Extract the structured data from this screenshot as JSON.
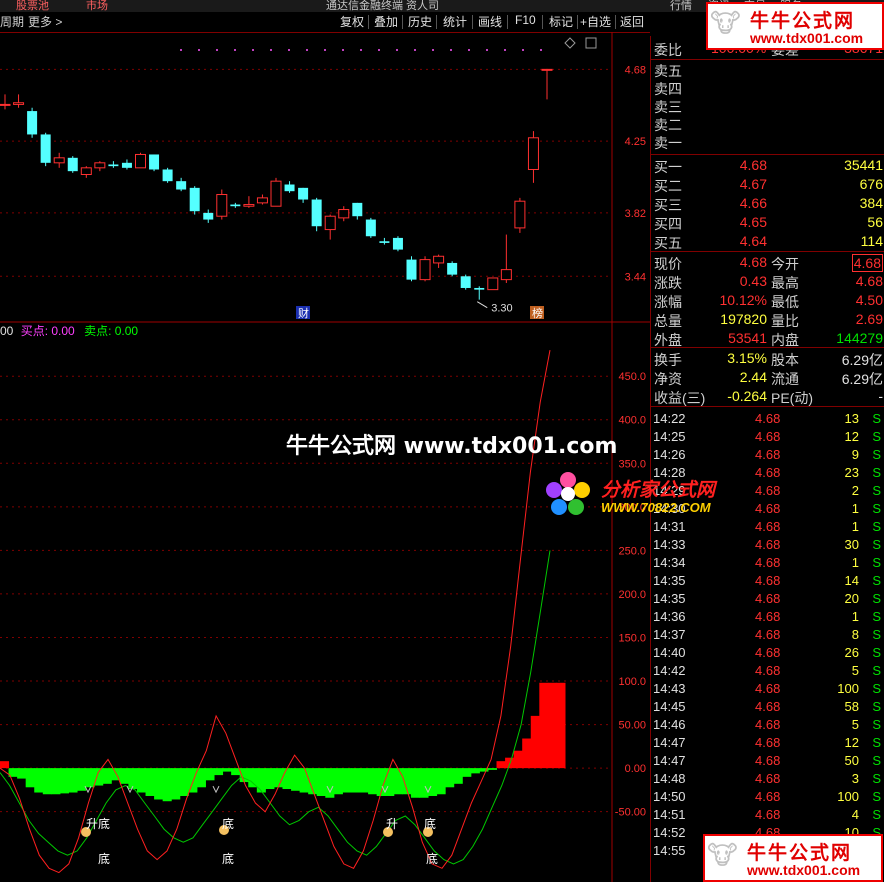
{
  "topbar": {
    "left1": "股票池",
    "left2": "市场",
    "center": "通达信金融终端 资人司",
    "r1": "行情",
    "r2": "资讯",
    "r3": "交易",
    "r4": "服务"
  },
  "toolbar": {
    "period": "周期",
    "more": "更多",
    "buttons": [
      "复权",
      "叠加",
      "历史",
      "统计",
      "画线",
      "F10",
      "标记",
      "+自选",
      "返回"
    ]
  },
  "indicator_label": {
    "prefix": "00",
    "buy": "买点: 0.00",
    "sell": "卖点: 0.00"
  },
  "watermarks": {
    "main": "牛牛公式网 www.tdx001.com",
    "fxj": "分析家公式网",
    "fxj_url": "WWW.70822.COM",
    "logo_text": "牛牛公式网",
    "logo_url": "www.tdx001.com"
  },
  "annotations": {
    "min_price": "3.30",
    "cai": "财",
    "bang": "榜"
  },
  "signals": {
    "sheng_di": "升底",
    "di": "底",
    "sheng": "升"
  },
  "colors": {
    "up": "#ff3030",
    "down": "#54ffff",
    "green_bar": "#00ff00",
    "red_bar": "#ff0000",
    "grid": "#800000"
  },
  "quote": {
    "weibi": {
      "label": "委比",
      "value": "100.00%",
      "label2": "委差",
      "value2": "38671"
    },
    "sell": [
      {
        "label": "卖五"
      },
      {
        "label": "卖四"
      },
      {
        "label": "卖三"
      },
      {
        "label": "卖二"
      },
      {
        "label": "卖一"
      }
    ],
    "buy": [
      {
        "label": "买一",
        "price": "4.68",
        "vol": "35441"
      },
      {
        "label": "买二",
        "price": "4.67",
        "vol": "676"
      },
      {
        "label": "买三",
        "price": "4.66",
        "vol": "384"
      },
      {
        "label": "买四",
        "price": "4.65",
        "vol": "56"
      },
      {
        "label": "买五",
        "price": "4.64",
        "vol": "114"
      }
    ],
    "stats": [
      {
        "l": "现价",
        "v": "4.68",
        "l2": "今开",
        "v2": "4.68"
      },
      {
        "l": "涨跌",
        "v": "0.43",
        "l2": "最高",
        "v2": "4.68"
      },
      {
        "l": "涨幅",
        "v": "10.12%",
        "l2": "最低",
        "v2": "4.50"
      },
      {
        "l": "总量",
        "v": "197820",
        "l2": "量比",
        "v2": "2.69"
      },
      {
        "l": "外盘",
        "v": "53541",
        "l2": "内盘",
        "v2": "144279"
      }
    ],
    "stats2": [
      {
        "l": "换手",
        "v": "3.15%",
        "l2": "股本",
        "v2": "6.29亿"
      },
      {
        "l": "净资",
        "v": "2.44",
        "l2": "流通",
        "v2": "6.29亿"
      },
      {
        "l": "收益(三)",
        "v": "-0.264",
        "l2": "PE(动)",
        "v2": "-"
      }
    ]
  },
  "ticks": [
    {
      "t": "14:22",
      "p": "4.68",
      "q": "13",
      "s": "S"
    },
    {
      "t": "14:25",
      "p": "4.68",
      "q": "12",
      "s": "S"
    },
    {
      "t": "14:26",
      "p": "4.68",
      "q": "9",
      "s": "S"
    },
    {
      "t": "14:28",
      "p": "4.68",
      "q": "23",
      "s": "S"
    },
    {
      "t": "14:29",
      "p": "4.68",
      "q": "2",
      "s": "S"
    },
    {
      "t": "14:30",
      "p": "4.68",
      "q": "1",
      "s": "S"
    },
    {
      "t": "14:31",
      "p": "4.68",
      "q": "1",
      "s": "S"
    },
    {
      "t": "14:33",
      "p": "4.68",
      "q": "30",
      "s": "S"
    },
    {
      "t": "14:34",
      "p": "4.68",
      "q": "1",
      "s": "S"
    },
    {
      "t": "14:35",
      "p": "4.68",
      "q": "14",
      "s": "S"
    },
    {
      "t": "14:35",
      "p": "4.68",
      "q": "20",
      "s": "S"
    },
    {
      "t": "14:36",
      "p": "4.68",
      "q": "1",
      "s": "S"
    },
    {
      "t": "14:37",
      "p": "4.68",
      "q": "8",
      "s": "S"
    },
    {
      "t": "14:40",
      "p": "4.68",
      "q": "26",
      "s": "S"
    },
    {
      "t": "14:42",
      "p": "4.68",
      "q": "5",
      "s": "S"
    },
    {
      "t": "14:43",
      "p": "4.68",
      "q": "100",
      "s": "S"
    },
    {
      "t": "14:45",
      "p": "4.68",
      "q": "58",
      "s": "S"
    },
    {
      "t": "14:46",
      "p": "4.68",
      "q": "5",
      "s": "S"
    },
    {
      "t": "14:47",
      "p": "4.68",
      "q": "12",
      "s": "S"
    },
    {
      "t": "14:47",
      "p": "4.68",
      "q": "50",
      "s": "S"
    },
    {
      "t": "14:48",
      "p": "4.68",
      "q": "3",
      "s": "S"
    },
    {
      "t": "14:50",
      "p": "4.68",
      "q": "100",
      "s": "S"
    },
    {
      "t": "14:51",
      "p": "4.68",
      "q": "4",
      "s": "S"
    },
    {
      "t": "14:52",
      "p": "4.68",
      "q": "10",
      "s": "S"
    },
    {
      "t": "14:55",
      "p": "4.68",
      "q": "4",
      "s": "S"
    }
  ],
  "chart_data": [
    {
      "type": "candlestick",
      "y_ticks": [
        "4.68",
        "4.25",
        "3.82",
        "3.44"
      ],
      "ylim": [
        3.25,
        4.82
      ],
      "candles": [
        {
          "o": 4.47,
          "h": 4.53,
          "l": 4.44,
          "c": 4.47
        },
        {
          "o": 4.47,
          "h": 4.53,
          "l": 4.45,
          "c": 4.48
        },
        {
          "o": 4.43,
          "h": 4.45,
          "l": 4.27,
          "c": 4.29
        },
        {
          "o": 4.29,
          "h": 4.3,
          "l": 4.1,
          "c": 4.12
        },
        {
          "o": 4.12,
          "h": 4.18,
          "l": 4.09,
          "c": 4.15
        },
        {
          "o": 4.15,
          "h": 4.16,
          "l": 4.06,
          "c": 4.07
        },
        {
          "o": 4.05,
          "h": 4.1,
          "l": 4.03,
          "c": 4.09
        },
        {
          "o": 4.09,
          "h": 4.13,
          "l": 4.07,
          "c": 4.12
        },
        {
          "o": 4.11,
          "h": 4.13,
          "l": 4.09,
          "c": 4.1
        },
        {
          "o": 4.12,
          "h": 4.14,
          "l": 4.08,
          "c": 4.09
        },
        {
          "o": 4.09,
          "h": 4.18,
          "l": 4.09,
          "c": 4.17
        },
        {
          "o": 4.17,
          "h": 4.17,
          "l": 4.07,
          "c": 4.08
        },
        {
          "o": 4.08,
          "h": 4.09,
          "l": 4.0,
          "c": 4.01
        },
        {
          "o": 4.01,
          "h": 4.03,
          "l": 3.95,
          "c": 3.96
        },
        {
          "o": 3.97,
          "h": 3.98,
          "l": 3.81,
          "c": 3.83
        },
        {
          "o": 3.82,
          "h": 3.84,
          "l": 3.76,
          "c": 3.78
        },
        {
          "o": 3.8,
          "h": 3.96,
          "l": 3.78,
          "c": 3.93
        },
        {
          "o": 3.87,
          "h": 3.88,
          "l": 3.85,
          "c": 3.86
        },
        {
          "o": 3.86,
          "h": 3.92,
          "l": 3.85,
          "c": 3.87
        },
        {
          "o": 3.88,
          "h": 3.93,
          "l": 3.87,
          "c": 3.91
        },
        {
          "o": 3.86,
          "h": 4.03,
          "l": 3.86,
          "c": 4.01
        },
        {
          "o": 3.99,
          "h": 4.01,
          "l": 3.94,
          "c": 3.95
        },
        {
          "o": 3.97,
          "h": 3.97,
          "l": 3.88,
          "c": 3.9
        },
        {
          "o": 3.9,
          "h": 3.91,
          "l": 3.71,
          "c": 3.74
        },
        {
          "o": 3.72,
          "h": 3.81,
          "l": 3.66,
          "c": 3.8
        },
        {
          "o": 3.79,
          "h": 3.86,
          "l": 3.77,
          "c": 3.84
        },
        {
          "o": 3.88,
          "h": 3.88,
          "l": 3.78,
          "c": 3.8
        },
        {
          "o": 3.78,
          "h": 3.79,
          "l": 3.67,
          "c": 3.68
        },
        {
          "o": 3.65,
          "h": 3.67,
          "l": 3.63,
          "c": 3.64
        },
        {
          "o": 3.67,
          "h": 3.68,
          "l": 3.59,
          "c": 3.6
        },
        {
          "o": 3.54,
          "h": 3.56,
          "l": 3.41,
          "c": 3.42
        },
        {
          "o": 3.42,
          "h": 3.56,
          "l": 3.41,
          "c": 3.54
        },
        {
          "o": 3.52,
          "h": 3.57,
          "l": 3.49,
          "c": 3.56
        },
        {
          "o": 3.52,
          "h": 3.53,
          "l": 3.44,
          "c": 3.45
        },
        {
          "o": 3.44,
          "h": 3.45,
          "l": 3.36,
          "c": 3.37
        },
        {
          "o": 3.37,
          "h": 3.38,
          "l": 3.3,
          "c": 3.36
        },
        {
          "o": 3.36,
          "h": 3.43,
          "l": 3.36,
          "c": 3.43
        },
        {
          "o": 3.42,
          "h": 3.69,
          "l": 3.4,
          "c": 3.48
        },
        {
          "o": 3.73,
          "h": 3.91,
          "l": 3.7,
          "c": 3.89
        },
        {
          "o": 4.08,
          "h": 4.31,
          "l": 4.0,
          "c": 4.27
        },
        {
          "o": 4.68,
          "h": 4.68,
          "l": 4.5,
          "c": 4.68
        }
      ]
    },
    {
      "type": "bar",
      "title": "",
      "y_ticks": [
        "450.0",
        "400.0",
        "350.0",
        "300.0",
        "250.0",
        "200.0",
        "150.0",
        "100.0",
        "50.00",
        "0.00",
        "-50.00"
      ],
      "ylim": [
        -125,
        495
      ],
      "values": [
        8,
        -10,
        -12,
        -22,
        -28,
        -30,
        -30,
        -29,
        -28,
        -26,
        -22,
        -20,
        -18,
        -14,
        -18,
        -24,
        -28,
        -32,
        -36,
        -38,
        -36,
        -32,
        -28,
        -22,
        -14,
        -8,
        -4,
        -8,
        -16,
        -22,
        -28,
        -24,
        -22,
        -24,
        -26,
        -28,
        -30,
        -32,
        -34,
        -30,
        -28,
        -28,
        -28,
        -30,
        -32,
        -32,
        -30,
        -30,
        -34,
        -34,
        -32,
        -30,
        -22,
        -18,
        -10,
        -6,
        -4,
        -2,
        8,
        12,
        20,
        34,
        60,
        98,
        98,
        98
      ],
      "series": [
        {
          "values": [
            -5,
            -20,
            -40,
            -60,
            -75,
            -85,
            -95,
            -100,
            -95,
            -80,
            -60,
            -40,
            -25,
            -20,
            -25,
            -40,
            -55,
            -70,
            -80,
            -85,
            -80,
            -65,
            -50,
            -35,
            -20,
            -10,
            -15,
            -25,
            -40,
            -55,
            -65,
            -60,
            -50,
            -45,
            -55,
            -70,
            -85,
            -95,
            -100,
            -90,
            -75,
            -60,
            -55,
            -65,
            -80,
            -95,
            -105,
            -110,
            -105,
            -90,
            -70,
            -45,
            -20,
            10,
            50,
            110,
            180,
            250
          ]
        },
        {
          "values": [
            0,
            -8,
            -35,
            -70,
            -100,
            -115,
            -120,
            -110,
            -80,
            -40,
            -5,
            10,
            -10,
            -40,
            -70,
            -95,
            -105,
            -95,
            -70,
            -35,
            -5,
            20,
            60,
            40,
            10,
            -20,
            -40,
            -50,
            -30,
            -5,
            15,
            0,
            -30,
            -60,
            -90,
            -110,
            -115,
            -95,
            -60,
            -20,
            10,
            -10,
            -45,
            -85,
            -110,
            -115,
            -100,
            -70,
            -40,
            -15,
            10,
            60,
            140,
            240,
            340,
            420,
            480
          ]
        }
      ]
    }
  ]
}
